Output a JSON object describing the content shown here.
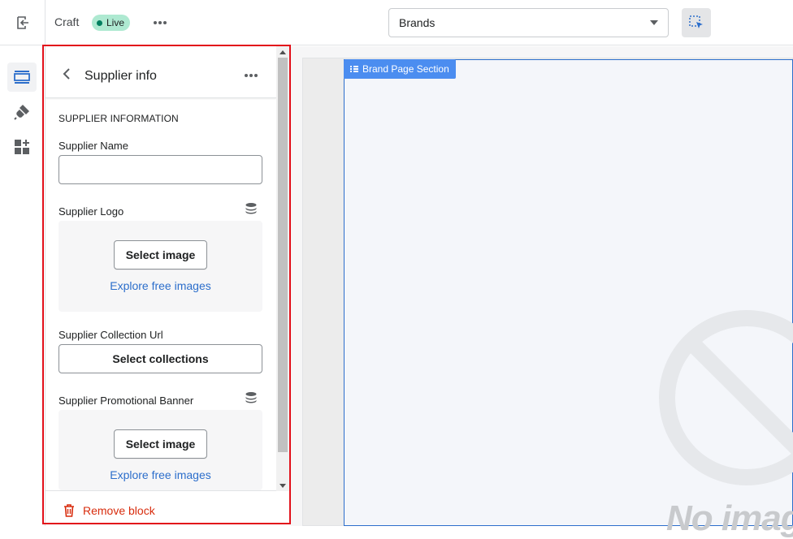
{
  "topbar": {
    "theme_name": "Craft",
    "status_badge": "Live",
    "template_select": {
      "selected": "Brands"
    }
  },
  "rail": {
    "items": [
      {
        "icon": "sections-icon",
        "active": true
      },
      {
        "icon": "theme-settings-icon",
        "active": false
      },
      {
        "icon": "app-embeds-icon",
        "active": false
      }
    ]
  },
  "panel": {
    "title": "Supplier info",
    "section_heading": "SUPPLIER INFORMATION",
    "supplier_name": {
      "label": "Supplier Name",
      "value": ""
    },
    "supplier_logo": {
      "label": "Supplier Logo",
      "select_label": "Select image",
      "explore_label": "Explore free images"
    },
    "collection_url": {
      "label": "Supplier Collection Url",
      "button_label": "Select collections"
    },
    "promo_banner": {
      "label": "Supplier Promotional Banner",
      "select_label": "Select image",
      "explore_label": "Explore free images"
    },
    "remove_label": "Remove block"
  },
  "preview": {
    "section_tag": "Brand Page Section",
    "placeholder_text": "No image"
  },
  "colors": {
    "accent": "#2c6ecb",
    "live_badge": "#aee9d1",
    "critical": "#d82c0d",
    "highlight_border": "#e2101a",
    "section_tag_bg": "#4b8df0"
  }
}
